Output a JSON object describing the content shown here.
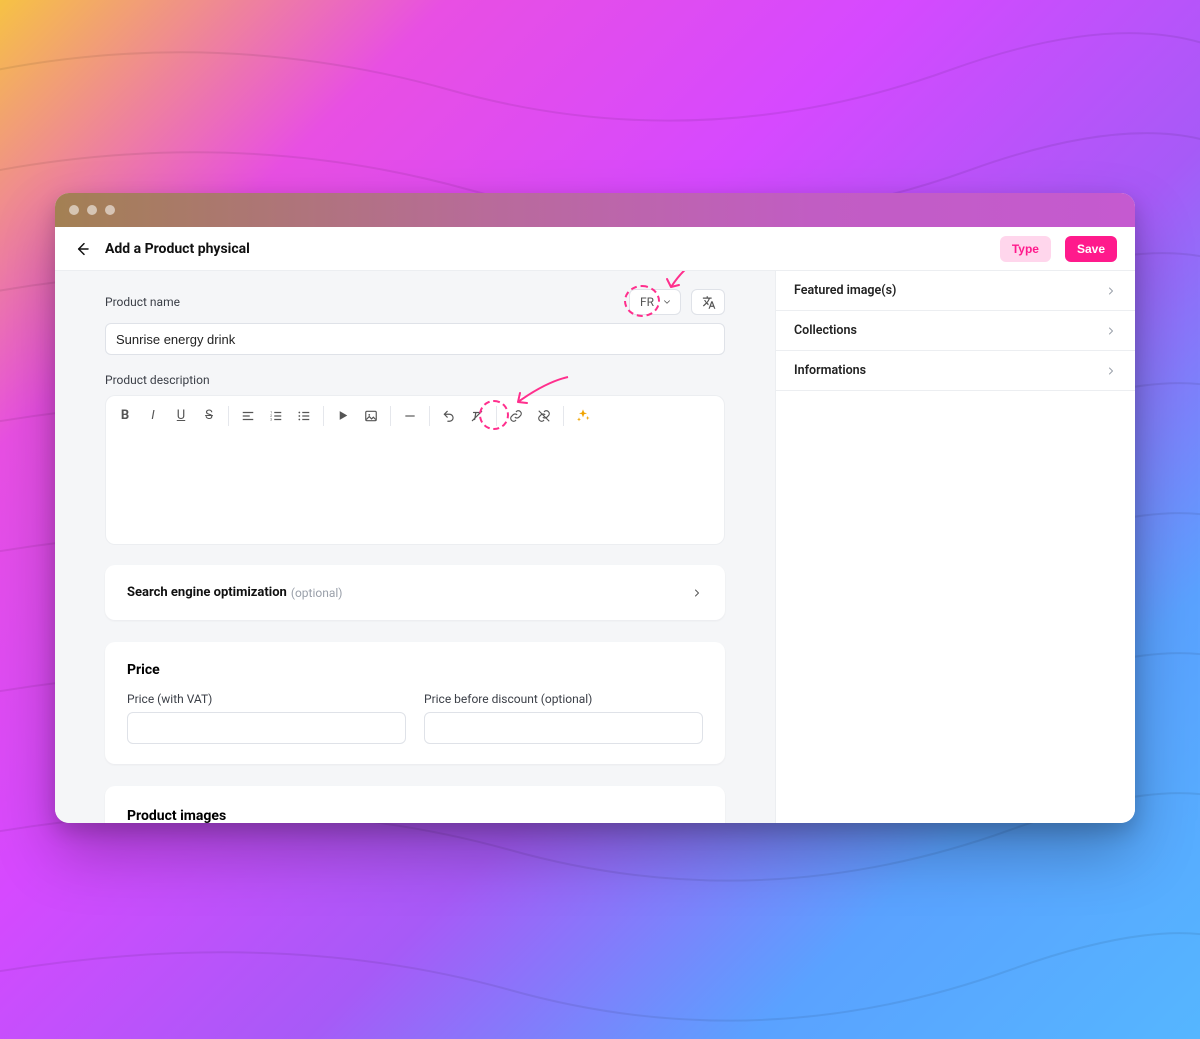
{
  "header": {
    "title": "Add a Product physical",
    "type_button": "Type",
    "save_button": "Save"
  },
  "form": {
    "name_label": "Product name",
    "name_value": "Sunrise energy drink",
    "lang_selector": "FR",
    "desc_label": "Product description"
  },
  "seo": {
    "title": "Search engine optimization",
    "optional": "(optional)"
  },
  "price": {
    "heading": "Price",
    "vat_label": "Price (with VAT)",
    "before_label": "Price before discount (optional)"
  },
  "images": {
    "heading": "Product images"
  },
  "sidebar": {
    "items": [
      {
        "label": "Featured image(s)"
      },
      {
        "label": "Collections"
      },
      {
        "label": "Informations"
      }
    ]
  }
}
